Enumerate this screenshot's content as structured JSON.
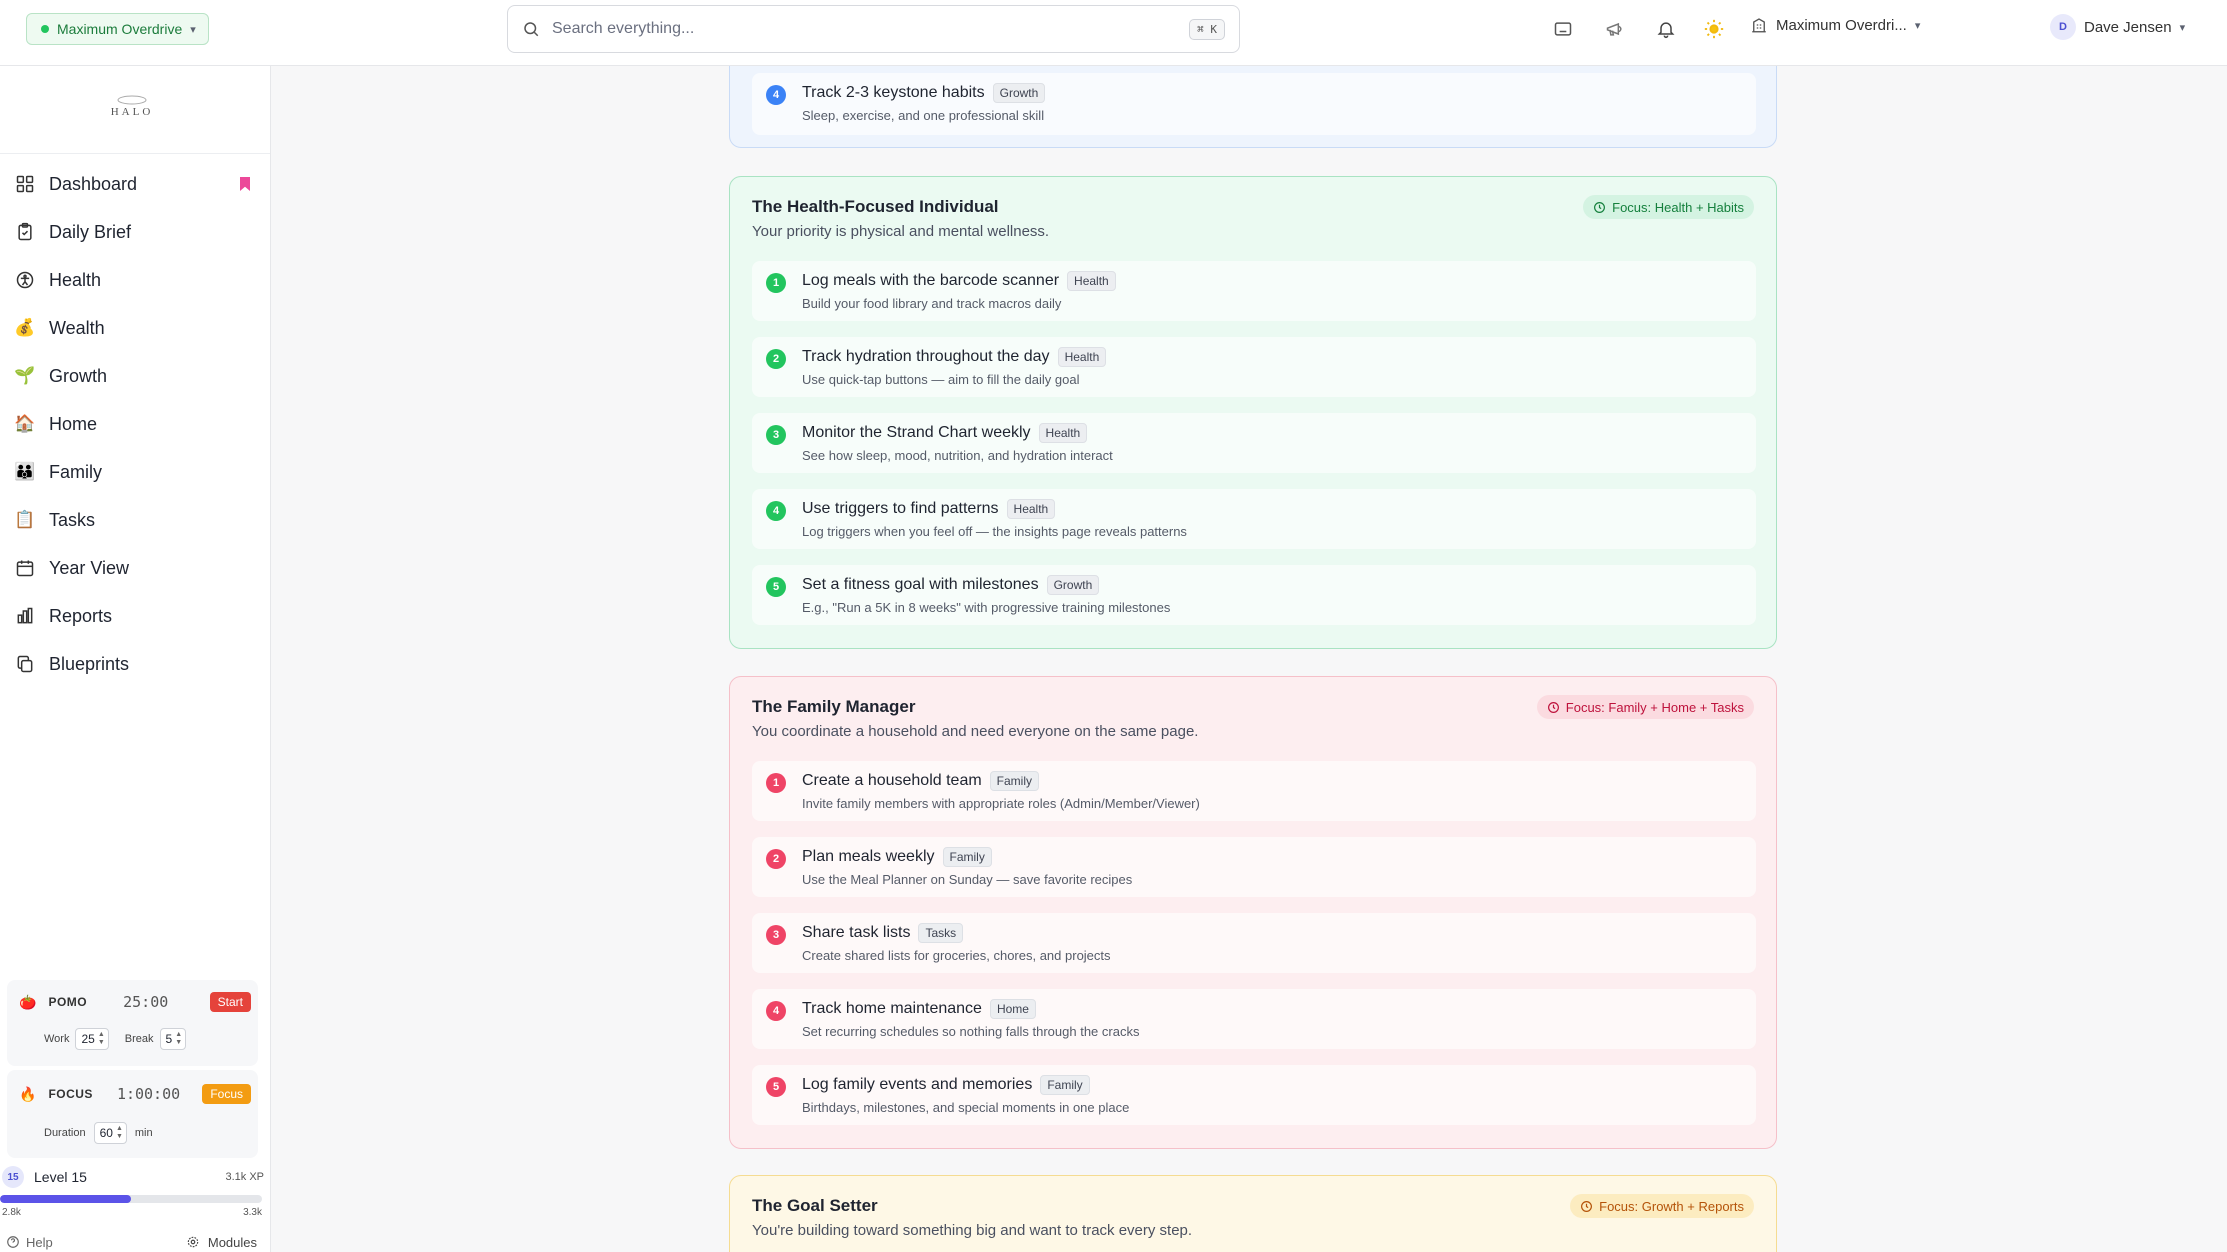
{
  "topbar": {
    "org_name": "Maximum Overdrive",
    "search_placeholder": "Search everything...",
    "search_shortcut": "⌘ K",
    "workspace_name": "Maximum Overdri...",
    "user_initial": "D",
    "user_name": "Dave Jensen"
  },
  "sidebar": {
    "logo_text": "HALO",
    "items": [
      {
        "label": "Dashboard",
        "icon": "grid-icon"
      },
      {
        "label": "Daily Brief",
        "icon": "clipboard-check-icon"
      },
      {
        "label": "Health",
        "icon": "accessibility-icon"
      },
      {
        "label": "Wealth",
        "icon": "money-bag-icon"
      },
      {
        "label": "Growth",
        "icon": "seedling-icon"
      },
      {
        "label": "Home",
        "icon": "house-icon"
      },
      {
        "label": "Family",
        "icon": "family-icon"
      },
      {
        "label": "Tasks",
        "icon": "clipboard-icon"
      },
      {
        "label": "Year View",
        "icon": "calendar-icon"
      },
      {
        "label": "Reports",
        "icon": "bar-chart-icon"
      },
      {
        "label": "Blueprints",
        "icon": "copy-icon"
      }
    ],
    "pomo": {
      "label": "POMO",
      "time": "25:00",
      "button": "Start",
      "work_label": "Work",
      "work_value": "25",
      "break_label": "Break",
      "break_value": "5"
    },
    "focus": {
      "label": "FOCUS",
      "time": "1:00:00",
      "button": "Focus",
      "duration_label": "Duration",
      "duration_value": "60",
      "unit": "min"
    },
    "level": {
      "badge": "15",
      "label": "Level 15",
      "xp": "3.1k XP",
      "min": "2.8k",
      "max": "3.3k",
      "progress": 0.5
    },
    "footer": {
      "help": "Help",
      "modules": "Modules"
    }
  },
  "colors": {
    "blue": "#3b82f6",
    "green": "#22c55e",
    "red": "#ef4466",
    "amber": "#f59e0b"
  },
  "cards": [
    {
      "id": "top",
      "title": "",
      "subtitle": "",
      "focus": "",
      "steps": [
        {
          "num": "4",
          "title": "Track 2-3 keystone habits",
          "tag": "Growth",
          "desc": "Sleep, exercise, and one professional skill"
        }
      ]
    },
    {
      "id": "health",
      "title": "The Health-Focused Individual",
      "subtitle": "Your priority is physical and mental wellness.",
      "focus": "Focus: Health + Habits",
      "steps": [
        {
          "num": "1",
          "title": "Log meals with the barcode scanner",
          "tag": "Health",
          "desc": "Build your food library and track macros daily"
        },
        {
          "num": "2",
          "title": "Track hydration throughout the day",
          "tag": "Health",
          "desc": "Use quick-tap buttons — aim to fill the daily goal"
        },
        {
          "num": "3",
          "title": "Monitor the Strand Chart weekly",
          "tag": "Health",
          "desc": "See how sleep, mood, nutrition, and hydration interact"
        },
        {
          "num": "4",
          "title": "Use triggers to find patterns",
          "tag": "Health",
          "desc": "Log triggers when you feel off — the insights page reveals patterns"
        },
        {
          "num": "5",
          "title": "Set a fitness goal with milestones",
          "tag": "Growth",
          "desc": "E.g., \"Run a 5K in 8 weeks\" with progressive training milestones"
        }
      ]
    },
    {
      "id": "family",
      "title": "The Family Manager",
      "subtitle": "You coordinate a household and need everyone on the same page.",
      "focus": "Focus: Family + Home + Tasks",
      "steps": [
        {
          "num": "1",
          "title": "Create a household team",
          "tag": "Family",
          "desc": "Invite family members with appropriate roles (Admin/Member/Viewer)"
        },
        {
          "num": "2",
          "title": "Plan meals weekly",
          "tag": "Family",
          "desc": "Use the Meal Planner on Sunday — save favorite recipes"
        },
        {
          "num": "3",
          "title": "Share task lists",
          "tag": "Tasks",
          "desc": "Create shared lists for groceries, chores, and projects"
        },
        {
          "num": "4",
          "title": "Track home maintenance",
          "tag": "Home",
          "desc": "Set recurring schedules so nothing falls through the cracks"
        },
        {
          "num": "5",
          "title": "Log family events and memories",
          "tag": "Family",
          "desc": "Birthdays, milestones, and special moments in one place"
        }
      ]
    },
    {
      "id": "goal",
      "title": "The Goal Setter",
      "subtitle": "You're building toward something big and want to track every step.",
      "focus": "Focus: Growth + Reports",
      "steps": []
    }
  ]
}
